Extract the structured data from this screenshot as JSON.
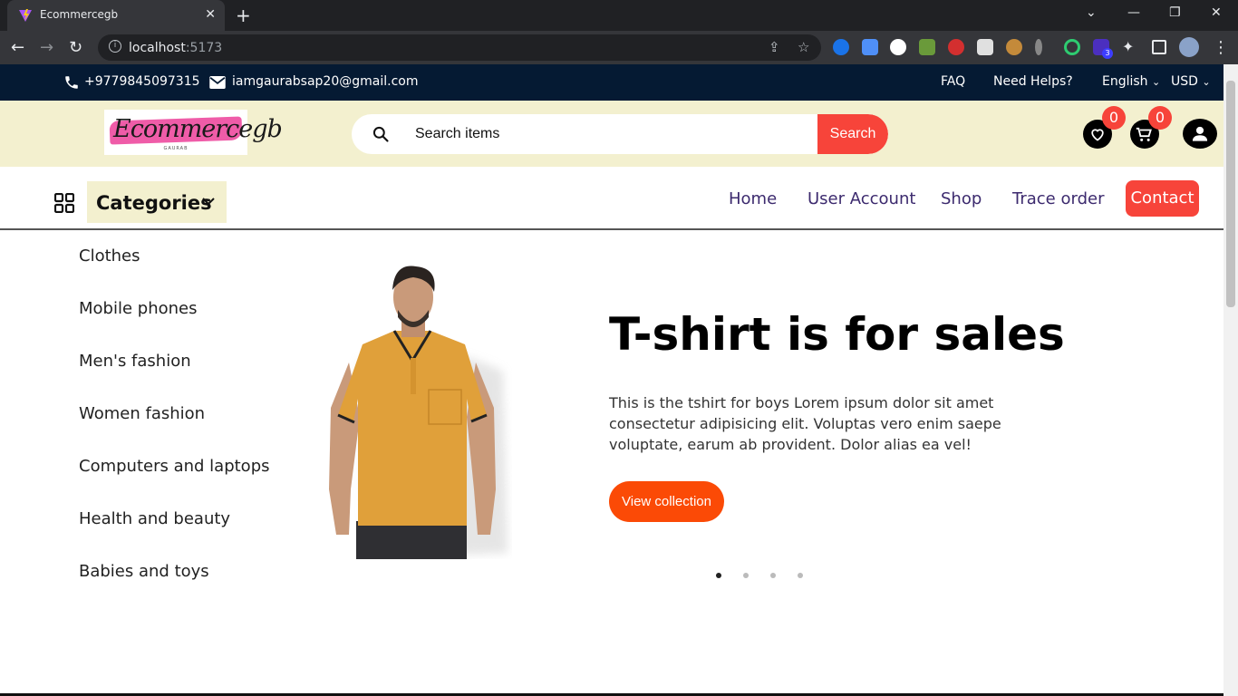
{
  "browser": {
    "tab_title": "Ecommercegb",
    "tab_close": "✕",
    "new_tab": "+",
    "url_host": "localhost",
    "url_port": ":5173",
    "extension_badge": "3"
  },
  "topbar": {
    "phone": "+9779845097315",
    "email": "iamgaurabsap20@gmail.com",
    "faq": "FAQ",
    "help": "Need Helps?",
    "language": "English",
    "currency": "USD"
  },
  "header": {
    "logo_text": "Ecommercegb",
    "logo_sub": "GAURAB",
    "search_placeholder": "Search items",
    "search_button": "Search",
    "wishlist_count": "0",
    "cart_count": "0"
  },
  "nav": {
    "categories_label": "Categories",
    "links": [
      "Home",
      "User Account",
      "Shop",
      "Trace order"
    ],
    "contact": "Contact"
  },
  "categories": [
    "Clothes",
    "Mobile phones",
    "Men's fashion",
    "Women fashion",
    "Computers and laptops",
    "Health and beauty",
    "Babies and toys"
  ],
  "hero": {
    "title": "T-shirt is for sales",
    "description": "This is the tshirt for boys Lorem ipsum dolor sit amet consectetur adipisicing elit. Voluptas vero enim saepe voluptate, earum ab provident. Dolor alias ea vel!",
    "button": "View collection",
    "active_slide": 1,
    "slide_count": 4
  },
  "colors": {
    "topbar_bg": "#051a33",
    "header_bg": "#f3f0cf",
    "accent_red": "#f7443a",
    "hero_button": "#fb4a06",
    "nav_link": "#3c2a6e"
  }
}
